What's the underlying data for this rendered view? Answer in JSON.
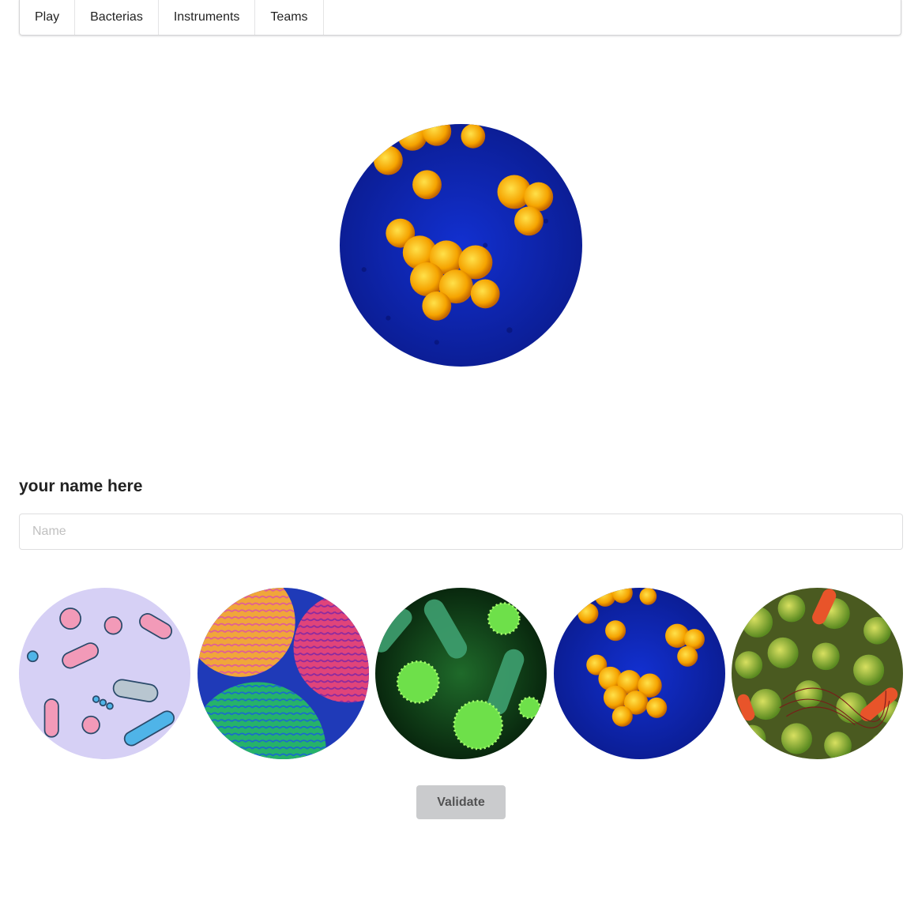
{
  "nav": {
    "items": [
      {
        "label": "Play"
      },
      {
        "label": "Bacterias"
      },
      {
        "label": "Instruments"
      },
      {
        "label": "Teams"
      }
    ]
  },
  "hero": {
    "icon": "bacteria-cluster-image"
  },
  "form": {
    "label": "your name here",
    "name_placeholder": "Name",
    "name_value": "",
    "validate_label": "Validate"
  },
  "avatars": [
    {
      "icon": "cartoon-bacteria-image"
    },
    {
      "icon": "pattern-cells-image"
    },
    {
      "icon": "green-virus-image"
    },
    {
      "icon": "bacteria-cluster-image"
    },
    {
      "icon": "bacteria-colony-image"
    }
  ],
  "colors": {
    "button_bg": "#cacbcd",
    "menu_border": "#d4d4d5"
  }
}
